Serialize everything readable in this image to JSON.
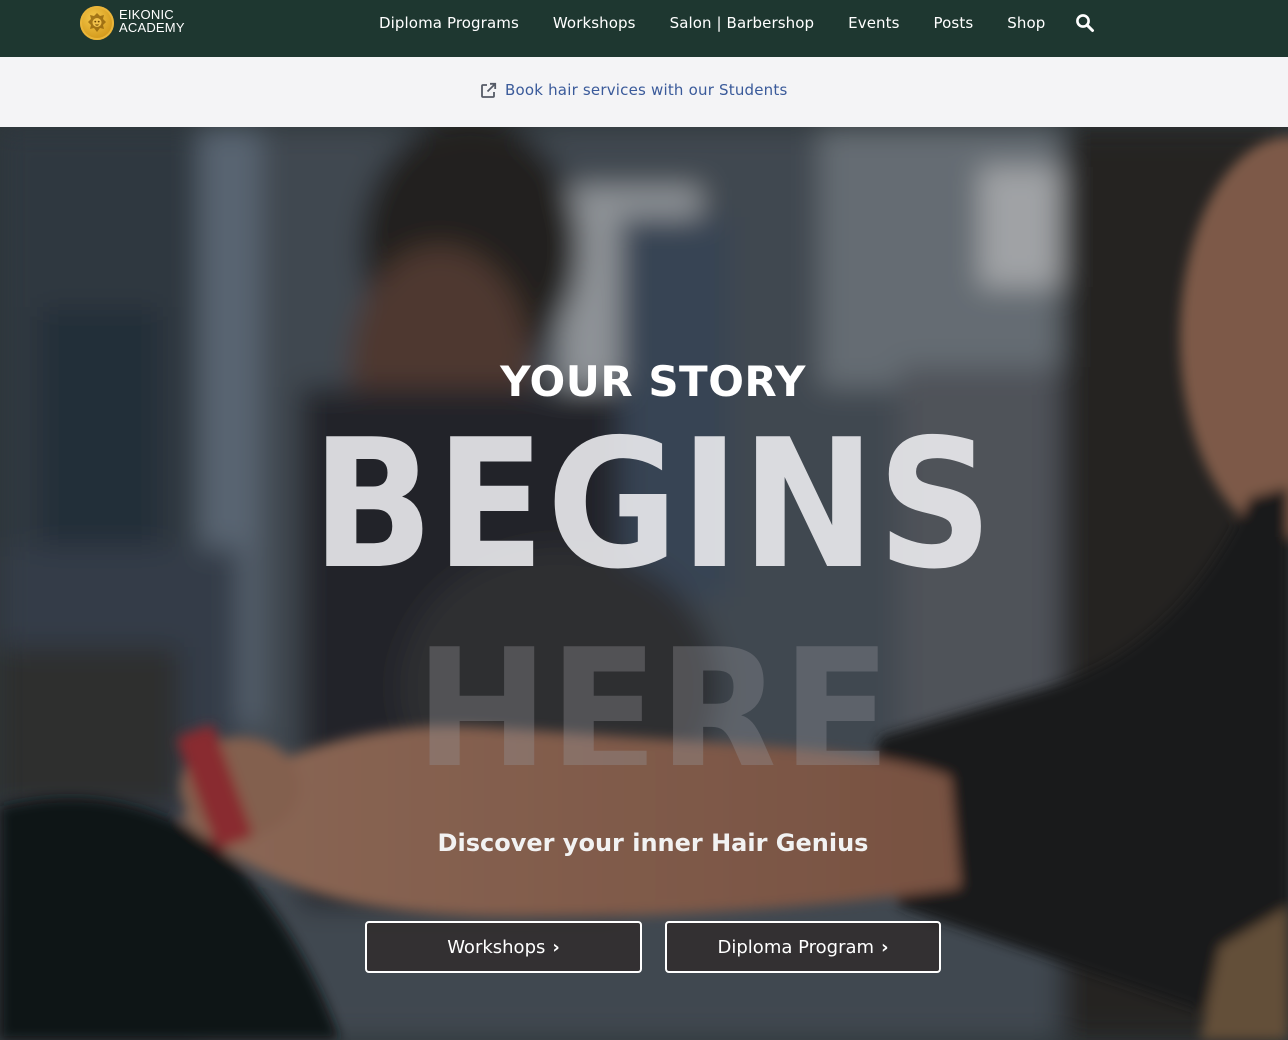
{
  "brand": {
    "name_line1": "EIKONIC",
    "name_line2": "ACADEMY",
    "logo_icon": "lion-head-icon",
    "accent_color": "#e2a626"
  },
  "nav": {
    "background": "#1e3730",
    "items": [
      {
        "label": "Diploma Programs"
      },
      {
        "label": "Workshops"
      },
      {
        "label": "Salon | Barbershop"
      },
      {
        "label": "Events"
      },
      {
        "label": "Posts"
      },
      {
        "label": "Shop"
      }
    ],
    "search_icon": "search-icon"
  },
  "notice": {
    "icon": "external-link-icon",
    "label": "Book hair services with our Students",
    "color": "#3a5a9a"
  },
  "hero": {
    "eyebrow": "YOUR STORY",
    "headline_line1": "BEGINS",
    "headline_line2": "HERE",
    "subtitle": "Discover your inner Hair Genius",
    "buttons": [
      {
        "label": "Workshops",
        "icon": "chevron-right-icon"
      },
      {
        "label": "Diploma Program",
        "icon": "chevron-right-icon"
      }
    ]
  }
}
